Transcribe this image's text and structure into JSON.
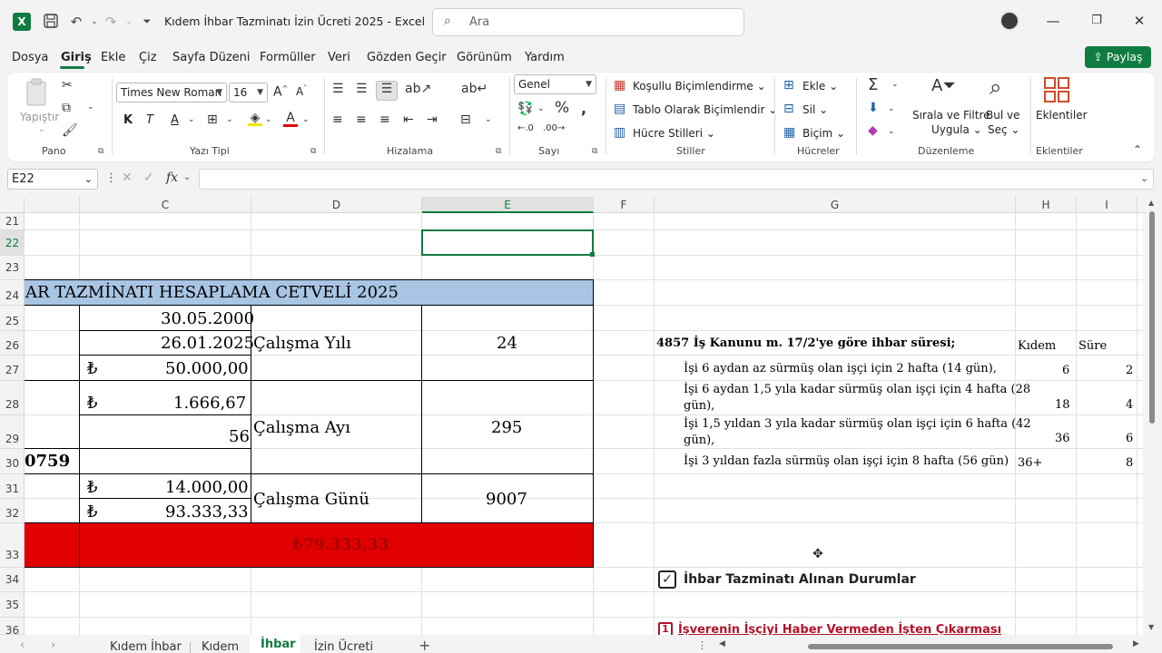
{
  "titlebar": {
    "title": "Kıdem İhbar Tazminatı İzin Ücreti 2025  -  Excel",
    "search_placeholder": "Ara",
    "app_logo": "X"
  },
  "menu": {
    "tabs": [
      "Dosya",
      "Giriş",
      "Ekle",
      "Çiz",
      "Sayfa Düzeni",
      "Formüller",
      "Veri",
      "Gözden Geçir",
      "Görünüm",
      "Yardım"
    ],
    "active": "Giriş",
    "share_label": "Paylaş"
  },
  "ribbon": {
    "clipboard": {
      "paste": "Yapıştır",
      "label": "Pano"
    },
    "font": {
      "name": "Times New Roman",
      "size": "16",
      "bold": "K",
      "italic": "T",
      "underline": "A",
      "label": "Yazı Tipi"
    },
    "alignment": {
      "label": "Hizalama"
    },
    "number": {
      "format": "Genel",
      "label": "Sayı"
    },
    "styles": {
      "conditional": "Koşullu Biçimlendirme",
      "table": "Tablo Olarak Biçimlendir",
      "cell_styles": "Hücre Stilleri",
      "label": "Stiller"
    },
    "cells": {
      "insert": "Ekle",
      "delete": "Sil",
      "format": "Biçim",
      "label": "Hücreler"
    },
    "editing": {
      "sort1": "Sırala ve Filtre",
      "sort2": "Uygula",
      "find1": "Bul ve",
      "find2": "Seç",
      "label": "Düzenleme"
    },
    "addins": {
      "name": "Eklentiler",
      "label": "Eklentiler"
    },
    "accent": "#107c41"
  },
  "formula_bar": {
    "name_box": "E22",
    "fx": "fx",
    "content": ""
  },
  "columns": [
    "C",
    "D",
    "E",
    "F",
    "G",
    "H",
    "I"
  ],
  "rows": [
    "21",
    "22",
    "23",
    "24",
    "25",
    "26",
    "27",
    "28",
    "29",
    "30",
    "31",
    "32",
    "33",
    "34",
    "35",
    "36"
  ],
  "selected_cell": "E22",
  "calc_table": {
    "header": "AR TAZMİNATI  HESAPLAMA CETVELİ 2025",
    "header_color": "#a9c5e4",
    "start_date": "30.05.2000",
    "end_date": "26.01.2025",
    "lira": "₺",
    "gross_wage": "50.000,00",
    "daily_wage": "1.666,67",
    "days_value": "56",
    "partial_number": "0759",
    "wage2": "14.000,00",
    "wage3": "93.333,33",
    "years_label": "Çalışma Yılı",
    "years_value": "24",
    "months_label": "Çalışma Ayı",
    "months_value": "295",
    "days_label": "Çalışma Günü",
    "days_total": "9007",
    "total": "₺79.333,33",
    "total_color": "#e00000"
  },
  "notice_table": {
    "title": "4857 İş Kanunu m. 17/2'ye göre ihbar süresi;",
    "col_kidem": "Kıdem",
    "col_sure": "Süre",
    "rows": [
      {
        "text": "İşi 6 aydan az sürmüş olan işçi için 2 hafta (14 gün),",
        "kidem": "6",
        "sure": "2"
      },
      {
        "text": "İşi 6 aydan 1,5 yıla kadar sürmüş olan işçi için 4 hafta (28",
        "text2": "gün),",
        "kidem": "18",
        "sure": "4"
      },
      {
        "text": "İşi 1,5 yıldan 3 yıla kadar sürmüş olan işçi için 6 hafta (42",
        "text2": "gün),",
        "kidem": "36",
        "sure": "6"
      },
      {
        "text": "İşi 3 yıldan fazla sürmüş olan işçi için 8 hafta (56 gün)",
        "kidem": "36+",
        "sure": "8"
      }
    ]
  },
  "cases": {
    "heading": "İhbar Tazminatı Alınan Durumlar",
    "item1_num": "1",
    "item1": "İşverenin İşçiyi Haber Vermeden İşten Çıkarması"
  },
  "sheets": {
    "tabs": [
      "Kıdem İhbar",
      "Kıdem",
      "İhbar",
      "İzin Ücreti"
    ],
    "active": "İhbar",
    "add": "+"
  }
}
